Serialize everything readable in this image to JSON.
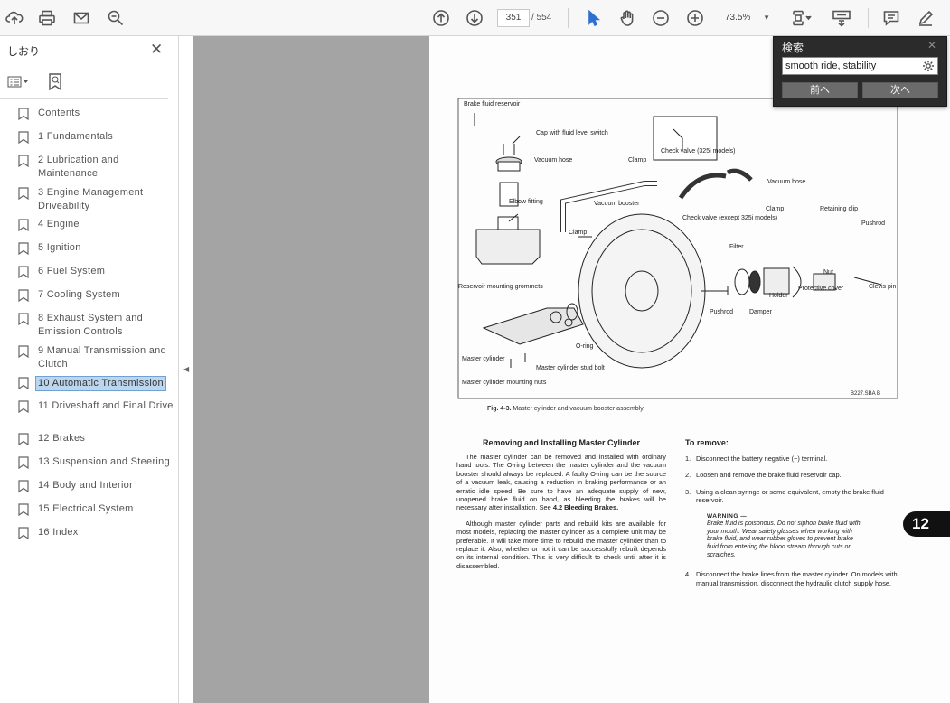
{
  "toolbar": {
    "page_current": "351",
    "page_total": "/ 554",
    "zoom": "73.5%"
  },
  "sidebar": {
    "title": "しおり",
    "items": [
      {
        "label": "Contents"
      },
      {
        "label": "1  Fundamentals"
      },
      {
        "label": "2  Lubrication and Maintenance"
      },
      {
        "label": "3  Engine Management Driveability"
      },
      {
        "label": "4  Engine"
      },
      {
        "label": "5  Ignition"
      },
      {
        "label": "6  Fuel System"
      },
      {
        "label": "7  Cooling System"
      },
      {
        "label": "8  Exhaust System and Emission Controls"
      },
      {
        "label": "9  Manual Transmission and Clutch"
      },
      {
        "label": "10  Automatic Transmission"
      },
      {
        "label": "11  Driveshaft and Final Drive"
      },
      {
        "label": "12  Brakes"
      },
      {
        "label": "13  Suspension and Steering"
      },
      {
        "label": "14  Body and Interior"
      },
      {
        "label": "15  Electrical System"
      },
      {
        "label": "16  Index"
      }
    ],
    "selected_index": 10
  },
  "find": {
    "title": "検索",
    "query": "smooth ride, stability",
    "prev_label": "前へ",
    "next_label": "次へ"
  },
  "document": {
    "figure_labels": {
      "brake_fluid_reservoir": "Brake fluid reservoir",
      "cap_switch": "Cap with fluid level switch",
      "check_valve_325i": "Check valve (325i models)",
      "vacuum_hose_1": "Vacuum hose",
      "clamp_1": "Clamp",
      "vacuum_hose_2": "Vacuum hose",
      "elbow_fitting": "Elbow fitting",
      "vacuum_booster": "Vacuum booster",
      "check_valve_except": "Check valve (except 325i models)",
      "clamp_2": "Clamp",
      "retaining_clip": "Retaining clip",
      "pushrod_1": "Pushrod",
      "clamp_3": "Clamp",
      "filter": "Filter",
      "reservoir_grommets": "Reservoir mounting grommets",
      "nut": "Nut",
      "clevis_pin": "Clevis pin",
      "protective_cover": "Protective cover",
      "holder": "Holder",
      "damper": "Damper",
      "pushrod_2": "Pushrod",
      "o_ring": "O-ring",
      "master_cylinder": "Master cylinder",
      "stud_bolt": "Master cylinder stud bolt",
      "mounting_nuts": "Master cylinder mounting nuts",
      "figure_code": "B227.SBA B"
    },
    "caption_label": "Fig. 4-3.",
    "caption_text": "Master cylinder and vacuum booster assembly.",
    "left_heading": "Removing and Installing Master Cylinder",
    "left_p1": "The master cylinder can be removed and installed with ordinary hand tools. The O-ring between the master cylinder and the vacuum booster should always be replaced. A faulty O-ring can be the source of a vacuum leak, causing a reduction in braking performance or an erratic idle speed. Be sure to have an adequate supply of new, unopened brake fluid on hand, as bleeding the brakes will be necessary after installation. See",
    "left_p1_ref": "4.2 Bleeding Brakes.",
    "left_p2": "Although master cylinder parts and rebuild kits are available for most models, replacing the master cylinder as a complete unit may be preferable. It will take more time to rebuild the master cylinder than to replace it. Also, whether or not it can be successfully rebuilt depends on its internal condition. This is very difficult to check until after it is disassembled.",
    "right_heading": "To remove:",
    "steps": [
      {
        "num": "1.",
        "text": "Disconnect the battery negative (−) terminal."
      },
      {
        "num": "2.",
        "text": "Loosen and remove the brake fluid reservoir cap."
      },
      {
        "num": "3.",
        "text": "Using a clean syringe or some equivalent, empty the brake fluid reservoir."
      },
      {
        "num": "4.",
        "text": "Disconnect the brake lines from the master cylinder. On models with manual transmission, disconnect the hydraulic clutch supply hose."
      }
    ],
    "warning_title": "WARNING —",
    "warning_text": "Brake fluid is poisonous. Do not siphon brake fluid with your mouth. Wear safety glasses when working with brake fluid, and wear rubber gloves to prevent brake fluid from entering the blood stream through cuts or scratches.",
    "section_tab": "12"
  },
  "colors": {
    "toolbar_bg": "#f7f7f7",
    "viewer_bg": "#a4a4a4",
    "selection_bg": "#bcd6ee",
    "find_bg": "#2b2b2b"
  }
}
